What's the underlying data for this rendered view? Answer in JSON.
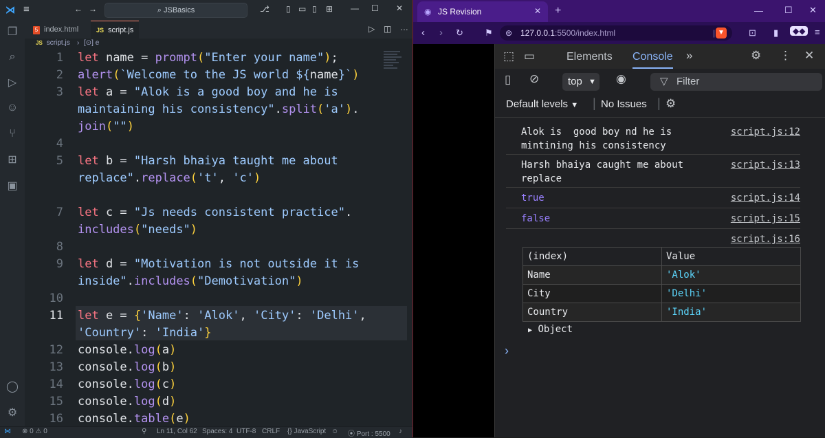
{
  "vscode": {
    "search": "JSBasics",
    "tabs": [
      {
        "label": "index.html",
        "type": "html"
      },
      {
        "label": "script.js",
        "type": "js"
      }
    ],
    "breadcrumb": {
      "file": "script.js",
      "symbol": "e"
    },
    "line_numbers": [
      "1",
      "2",
      "3",
      "4",
      "5",
      "7",
      "8",
      "9",
      "10",
      "11",
      "12",
      "13",
      "14",
      "15",
      "16"
    ],
    "current_line": "11",
    "status": {
      "errors": "0",
      "warnings": "0",
      "position": "Ln 11, Col 62",
      "spaces": "Spaces: 4",
      "encoding": "UTF-8",
      "eol": "CRLF",
      "language": "JavaScript",
      "port": "Port : 5500"
    }
  },
  "browser": {
    "tab_title": "JS Revision",
    "url_host": "127.0.0.1",
    "url_rest": ":5500/index.html",
    "devtools": {
      "tabs": [
        "Elements",
        "Console"
      ],
      "context": "top",
      "filter_placeholder": "Filter",
      "levels": "Default levels",
      "issues": "No Issues",
      "messages": [
        {
          "text": "Alok is  good boy nd he is\nmintining his consistency",
          "src": "script.js:12"
        },
        {
          "text": "Harsh bhaiya caught me about\nreplace",
          "src": "script.js:13"
        },
        {
          "text": "true",
          "src": "script.js:14"
        },
        {
          "text": "false",
          "src": "script.js:15"
        },
        {
          "text": "",
          "src": "script.js:16"
        }
      ],
      "table": {
        "headers": [
          "(index)",
          "Value"
        ],
        "rows": [
          {
            "index": "Name",
            "value": "'Alok'"
          },
          {
            "index": "City",
            "value": "'Delhi'"
          },
          {
            "index": "Country",
            "value": "'India'"
          }
        ]
      },
      "object_label": "Object",
      "prompt": "›"
    }
  },
  "colors": {
    "keyword": "#f97583",
    "function": "#b392f0",
    "string": "#9ecbff",
    "brave_accent": "#fb542b",
    "devtools_accent": "#8ab4f8"
  }
}
